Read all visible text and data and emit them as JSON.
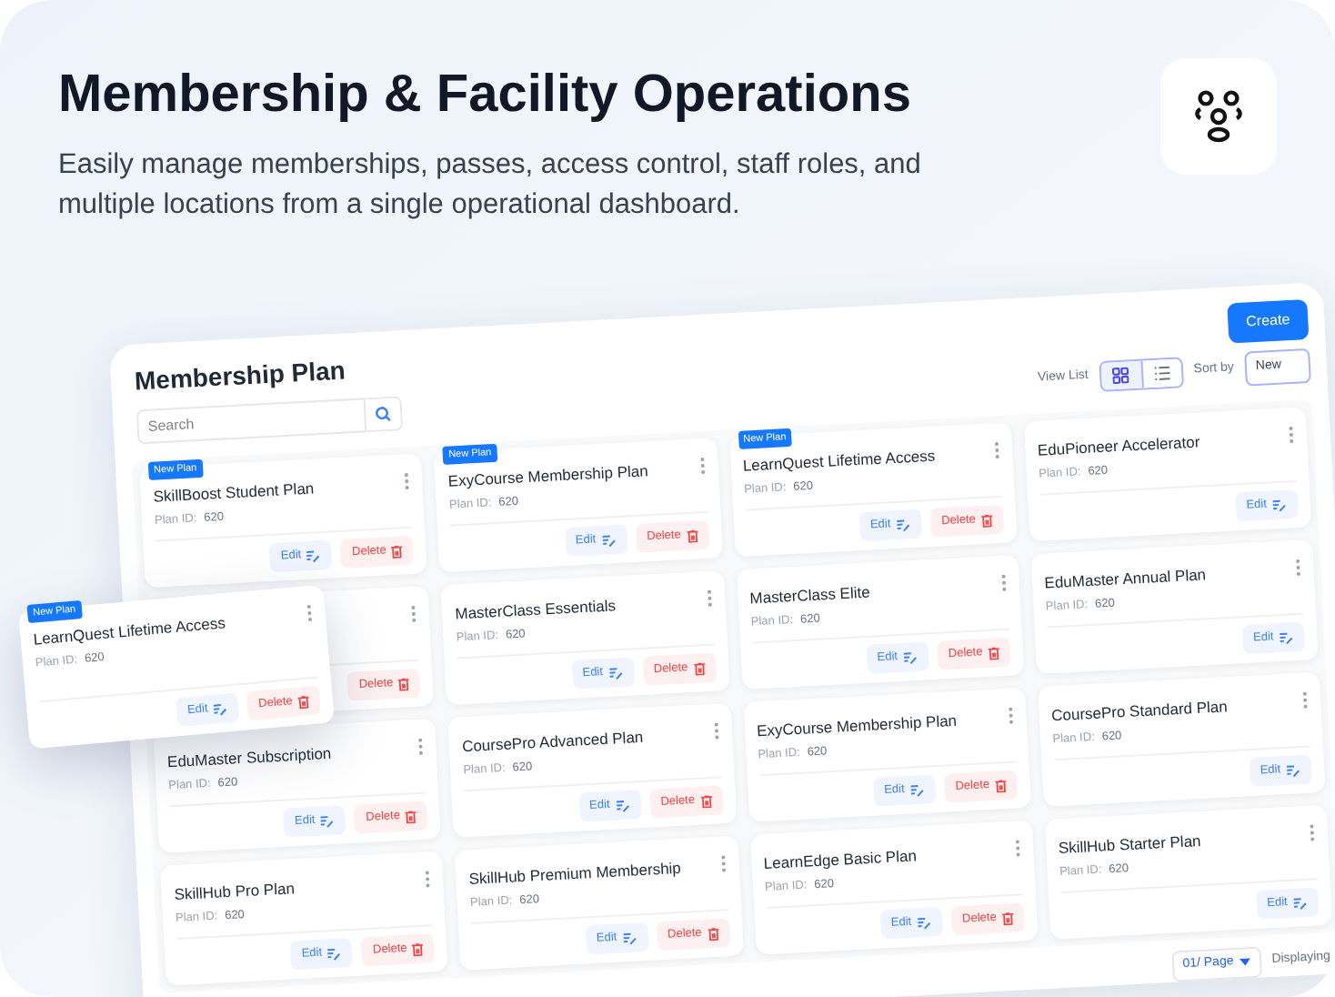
{
  "header": {
    "title": "Membership & Facility Operations",
    "subtitle": "Easily manage memberships, passes, access control, staff roles, and multiple locations from a single operational dashboard."
  },
  "dashboard": {
    "title": "Membership Plan",
    "search": {
      "placeholder": "Search"
    },
    "create_button": "Create",
    "view_label": "View List",
    "view_options": [
      {
        "kind": "grid",
        "selected": true
      },
      {
        "kind": "list",
        "selected": false
      }
    ],
    "sort_label": "Sort by",
    "sort_value": "New",
    "plans": [
      {
        "title": "SkillBoost Student Plan",
        "new_badge": "New Plan",
        "plan_id_label": "Plan ID:",
        "plan_id": "620",
        "edit": "Edit",
        "delete": "Delete"
      },
      {
        "title": "ExyCourse Membership Plan",
        "new_badge": "New Plan",
        "plan_id_label": "Plan ID:",
        "plan_id": "620",
        "edit": "Edit",
        "delete": "Delete"
      },
      {
        "title": "LearnQuest Lifetime Access",
        "new_badge": "New Plan",
        "plan_id_label": "Plan ID:",
        "plan_id": "620",
        "edit": "Edit",
        "delete": "Delete"
      },
      {
        "title": "EduPioneer Accelerator",
        "plan_id_label": "Plan ID:",
        "plan_id": "620",
        "edit": "Edit"
      },
      {
        "delete": "Delete"
      },
      {
        "title": "MasterClass Essentials",
        "plan_id_label": "Plan ID:",
        "plan_id": "620",
        "edit": "Edit",
        "delete": "Delete"
      },
      {
        "title": "MasterClass Elite",
        "plan_id_label": "Plan ID:",
        "plan_id": "620",
        "edit": "Edit",
        "delete": "Delete"
      },
      {
        "title": "EduMaster Annual Plan",
        "plan_id_label": "Plan ID:",
        "plan_id": "620",
        "edit": "Edit"
      },
      {
        "title": "EduMaster Subscription",
        "plan_id_label": "Plan ID:",
        "plan_id": "620",
        "edit": "Edit",
        "delete": "Delete"
      },
      {
        "title": "CoursePro Advanced Plan",
        "plan_id_label": "Plan ID:",
        "plan_id": "620",
        "edit": "Edit",
        "delete": "Delete"
      },
      {
        "title": "ExyCourse Membership Plan",
        "plan_id_label": "Plan ID:",
        "plan_id": "620",
        "edit": "Edit",
        "delete": "Delete"
      },
      {
        "title": "CoursePro Standard Plan",
        "plan_id_label": "Plan ID:",
        "plan_id": "620",
        "edit": "Edit"
      },
      {
        "title": "SkillHub Pro Plan",
        "plan_id_label": "Plan ID:",
        "plan_id": "620",
        "edit": "Edit",
        "delete": "Delete"
      },
      {
        "title": "SkillHub Premium Membership",
        "plan_id_label": "Plan ID:",
        "plan_id": "620",
        "edit": "Edit",
        "delete": "Delete"
      },
      {
        "title": "LearnEdge Basic Plan",
        "plan_id_label": "Plan ID:",
        "plan_id": "620",
        "edit": "Edit",
        "delete": "Delete"
      },
      {
        "title": "SkillHub Starter Plan",
        "plan_id_label": "Plan ID:",
        "plan_id": "620",
        "edit": "Edit"
      }
    ],
    "page_size": "01/ Page",
    "display_text": "Displaying"
  },
  "floating_card": {
    "title": "LearnQuest Lifetime Access",
    "new_badge": "New Plan",
    "plan_id_label": "Plan ID:",
    "plan_id": "620",
    "edit": "Edit",
    "delete": "Delete"
  }
}
